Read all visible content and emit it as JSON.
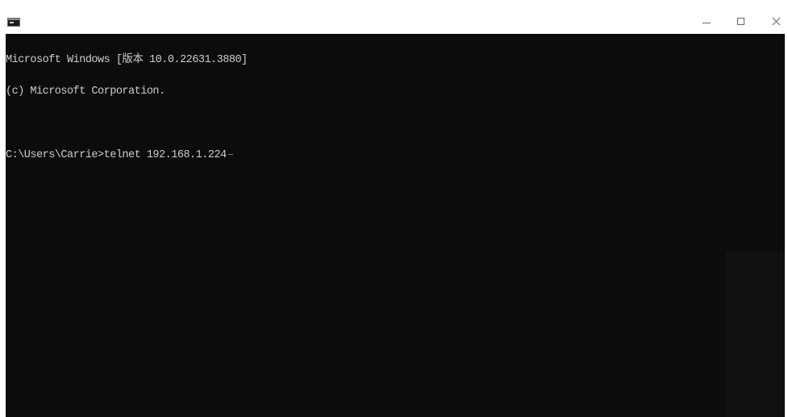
{
  "window": {
    "app_icon": "console-app-icon",
    "controls": {
      "minimize_icon": "minimize-icon",
      "maximize_icon": "maximize-icon",
      "close_icon": "close-icon"
    }
  },
  "console": {
    "background": "#0c0c0c",
    "foreground": "#cccccc",
    "lines": [
      "Microsoft Windows [版本 10.0.22631.3880]",
      "(c) Microsoft Corporation."
    ],
    "prompt": "C:\\Users\\Carrie>",
    "command": "telnet 192.168.1.224"
  }
}
